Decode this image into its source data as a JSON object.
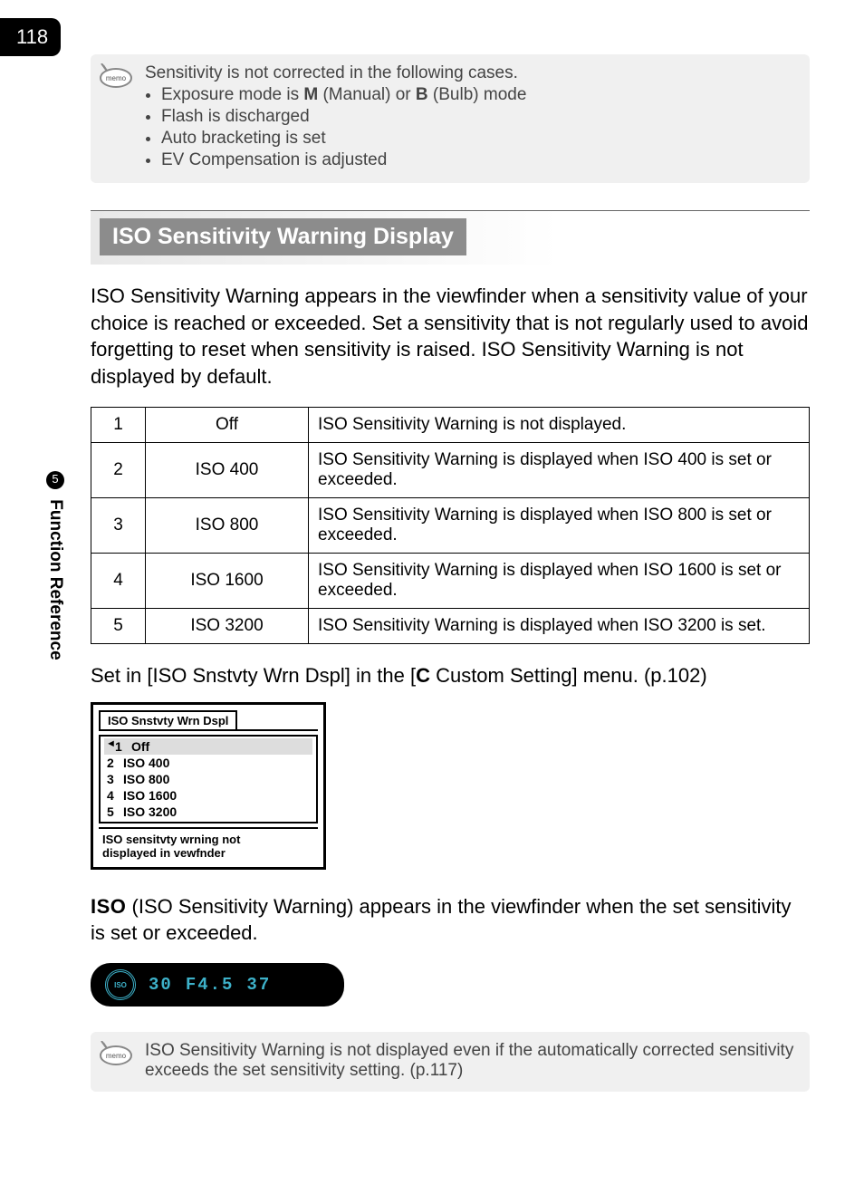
{
  "page_number": "118",
  "side_chapter_number": "5",
  "side_chapter_label": "Function Reference",
  "memo1": {
    "intro": "Sensitivity is not corrected in the following cases.",
    "b1_pre": "Exposure mode is ",
    "b1_m": "M",
    "b1_mid": " (Manual) or ",
    "b1_b": "B",
    "b1_post": " (Bulb) mode",
    "b2": "Flash is discharged",
    "b3": "Auto bracketing is set",
    "b4": "EV Compensation is adjusted"
  },
  "section_title": "ISO Sensitivity Warning Display",
  "intro_para": "ISO Sensitivity Warning appears in the viewfinder when a sensitivity value of your choice is reached or exceeded. Set a sensitivity that is not regularly used to avoid forgetting to reset when sensitivity is raised. ISO Sensitivity Warning is not displayed by default.",
  "table": {
    "r1": {
      "n": "1",
      "v": "Off",
      "d": "ISO Sensitivity Warning is not displayed."
    },
    "r2": {
      "n": "2",
      "v": "ISO 400",
      "d": "ISO Sensitivity Warning is displayed when ISO 400 is set or exceeded."
    },
    "r3": {
      "n": "3",
      "v": "ISO 800",
      "d": "ISO Sensitivity Warning is displayed when ISO 800 is set or exceeded."
    },
    "r4": {
      "n": "4",
      "v": "ISO 1600",
      "d": "ISO Sensitivity Warning is displayed when ISO 1600 is set or exceeded."
    },
    "r5": {
      "n": "5",
      "v": "ISO 3200",
      "d": "ISO Sensitivity Warning is displayed when ISO 3200 is set."
    }
  },
  "menu_line_pre": "Set in [ISO Snstvty Wrn Dspl] in the [",
  "menu_icon": "C",
  "menu_line_post": " Custom Setting] menu. (p.102)",
  "lcd": {
    "tab": "ISO Snstvty Wrn Dspl",
    "items": [
      {
        "n": "1",
        "label": "Off",
        "sel": true
      },
      {
        "n": "2",
        "label": "ISO 400",
        "sel": false
      },
      {
        "n": "3",
        "label": "ISO 800",
        "sel": false
      },
      {
        "n": "4",
        "label": "ISO 1600",
        "sel": false
      },
      {
        "n": "5",
        "label": "ISO 3200",
        "sel": false
      }
    ],
    "foot_l1": "ISO sensitvty wrning not",
    "foot_l2": "displayed in vewfnder"
  },
  "iso_glyph": "ISO",
  "iso_line": " (ISO Sensitivity Warning) appears in the viewfinder when the set sensitivity is set or exceeded.",
  "vf": {
    "iso": "ISO",
    "s1": "30",
    "s2": "F4.5",
    "s3": "37"
  },
  "memo2": "ISO Sensitivity Warning is not displayed even if the automatically corrected sensitivity exceeds the set sensitivity setting. (p.117)"
}
